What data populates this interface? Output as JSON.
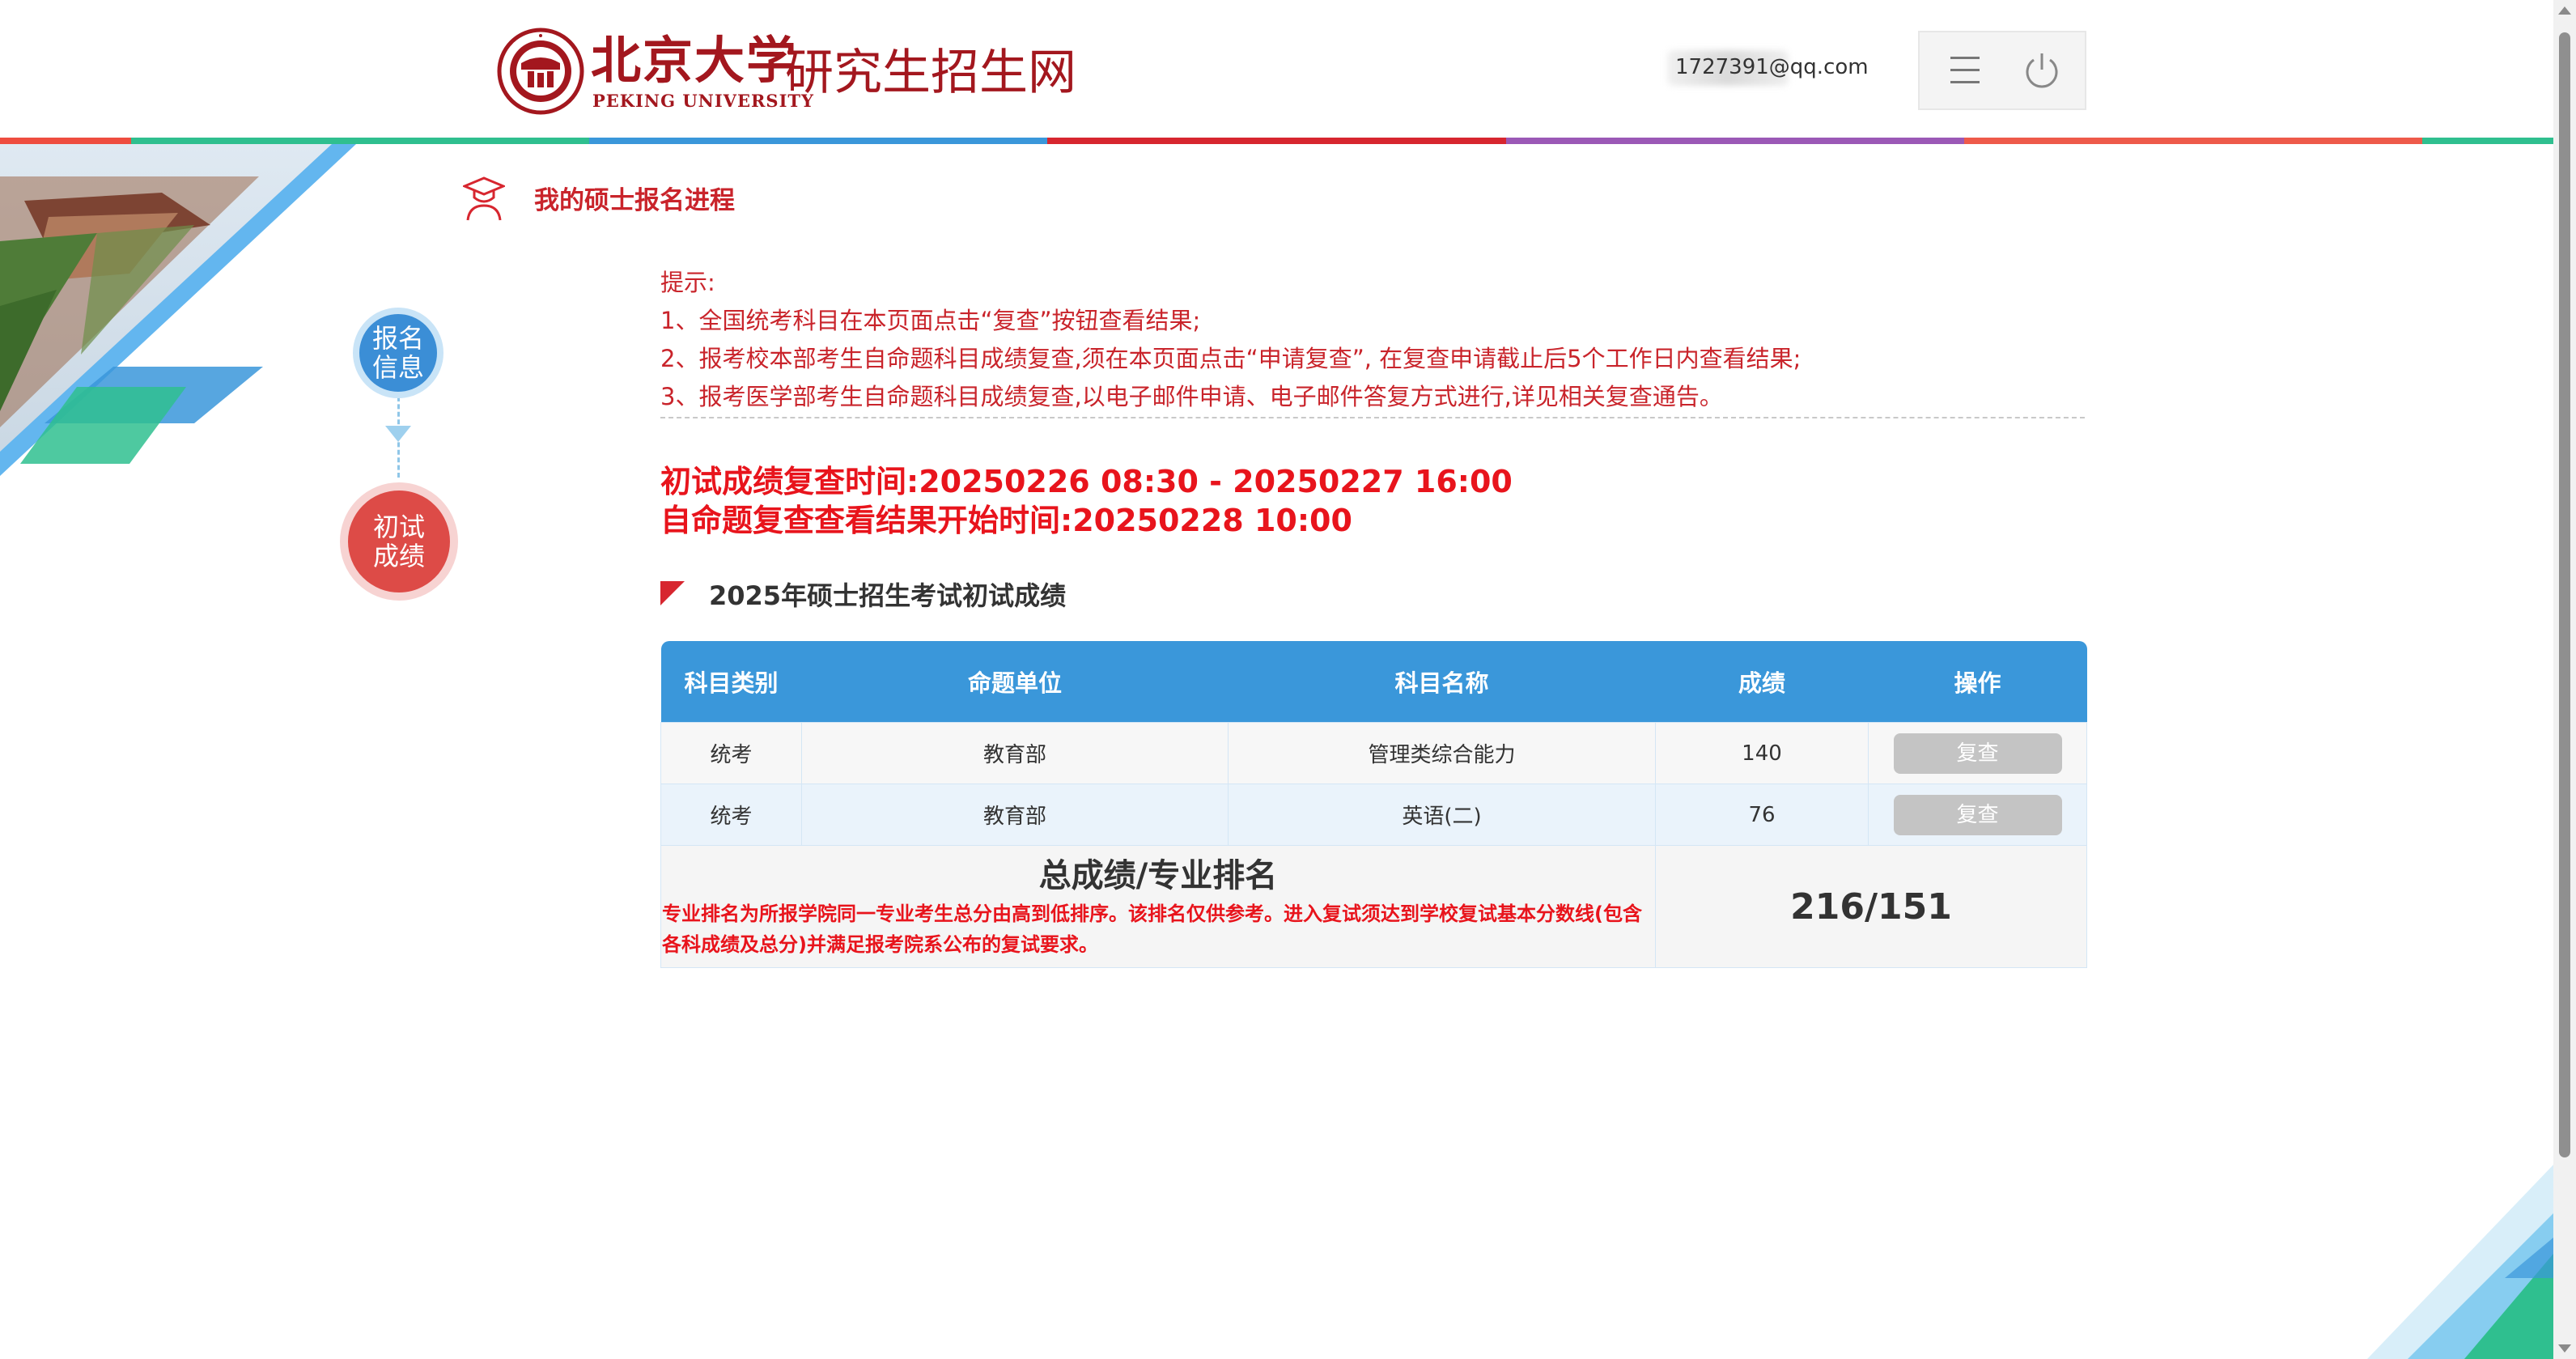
{
  "header": {
    "logo_cn": "北京大学",
    "logo_en": "PEKING UNIVERSITY",
    "site_title": "研究生招生网",
    "user_email": "1727391@qq.com"
  },
  "colors": {
    "brand_red": "#a3171e",
    "accent_blue": "#3a97da",
    "alert_red": "#e8141c",
    "stripe": [
      "#ee4d3f",
      "#2fbf8f",
      "#3a97da",
      "#d7262f",
      "#9b59b6",
      "#ee5a4a",
      "#2fbf8f"
    ]
  },
  "page": {
    "title": "我的硕士报名进程"
  },
  "steps": [
    {
      "label": "报名信息",
      "state": "done"
    },
    {
      "label": "初试成绩",
      "state": "current"
    }
  ],
  "notice": {
    "heading": "提示:",
    "lines": [
      "1、全国统考科目在本页面点击“复查”按钮查看结果;",
      "2、报考校本部考生自命题科目成绩复查,须在本页面点击“申请复查”, 在复查申请截止后5个工作日内查看结果;",
      "3、报考医学部考生自命题科目成绩复查,以电子邮件申请、电子邮件答复方式进行,详见相关复查通告。"
    ]
  },
  "deadlines": {
    "review_period": "初试成绩复查时间:20250226 08:30 - 20250227 16:00",
    "result_time": "自命题复查查看结果开始时间:20250228 10:00"
  },
  "section": {
    "title": "2025年硕士招生考试初试成绩"
  },
  "table": {
    "headers": [
      "科目类别",
      "命题单位",
      "科目名称",
      "成绩",
      "操作"
    ],
    "rows": [
      {
        "category": "统考",
        "unit": "教育部",
        "subject": "管理类综合能力",
        "score": "140",
        "action": "复查"
      },
      {
        "category": "统考",
        "unit": "教育部",
        "subject": "英语(二)",
        "score": "76",
        "action": "复查"
      }
    ],
    "total": {
      "title": "总成绩/专业排名",
      "note": "专业排名为所报学院同一专业考生总分由高到低排序。该排名仅供参考。进入复试须达到学校复试基本分数线(包含各科成绩及总分)并满足报考院系公布的复试要求。",
      "value": "216/151"
    }
  },
  "icons": {
    "menu": "menu-icon",
    "power": "power-icon",
    "graduate": "graduate-icon"
  }
}
